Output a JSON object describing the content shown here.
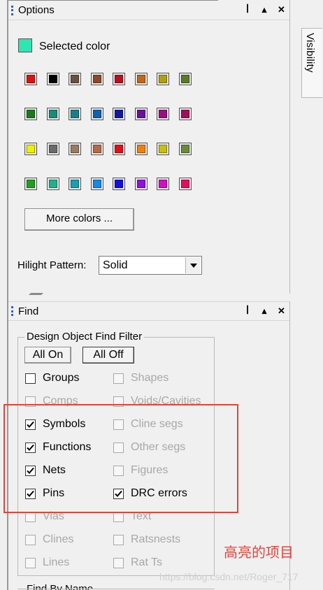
{
  "options_panel": {
    "title": "Options",
    "pin_icon": "pin-icon",
    "menu_icon": "triangle-up-icon",
    "close_icon": "close-icon",
    "selected_color": {
      "label": "Selected color",
      "color": "#2ee6b2"
    },
    "palette": [
      [
        "#e01010",
        "#000000",
        "#6b5040",
        "#8a4a2a",
        "#b81020",
        "#c06818",
        "#b0a010",
        "#5a7a2a"
      ],
      [
        "#1a7a1a",
        "#1a8a7a",
        "#18808a",
        "#1060b0",
        "#101a9a",
        "#6a109a",
        "#9a1080",
        "#a0105a"
      ],
      [
        "#f0f000",
        "#6a6a6a",
        "#9a7a60",
        "#b86848",
        "#e0101a",
        "#f08010",
        "#c8c010",
        "#6a8a3a"
      ],
      [
        "#20a020",
        "#20b090",
        "#18a0b0",
        "#1888e0",
        "#1010e0",
        "#9010e0",
        "#d010c0",
        "#e01060"
      ]
    ],
    "more_colors_label": "More colors ...",
    "hilight_pattern": {
      "label": "Hilight Pattern:",
      "value": "Solid"
    }
  },
  "visibility_tab": {
    "label": "Visibility"
  },
  "find_panel": {
    "title": "Find",
    "filter_group_label": "Design Object Find Filter",
    "all_on_label": "All On",
    "all_off_label": "All Off",
    "left_column": [
      {
        "label": "Groups",
        "checked": false,
        "enabled": true
      },
      {
        "label": "Comps",
        "checked": false,
        "enabled": false
      },
      {
        "label": "Symbols",
        "checked": true,
        "enabled": true
      },
      {
        "label": "Functions",
        "checked": true,
        "enabled": true
      },
      {
        "label": "Nets",
        "checked": true,
        "enabled": true
      },
      {
        "label": "Pins",
        "checked": true,
        "enabled": true
      },
      {
        "label": "Vias",
        "checked": false,
        "enabled": false
      },
      {
        "label": "Clines",
        "checked": false,
        "enabled": false
      },
      {
        "label": "Lines",
        "checked": false,
        "enabled": false
      }
    ],
    "right_column": [
      {
        "label": "Shapes",
        "checked": false,
        "enabled": false
      },
      {
        "label": "Voids/Cavities",
        "checked": false,
        "enabled": false
      },
      {
        "label": "Cline segs",
        "checked": false,
        "enabled": false
      },
      {
        "label": "Other segs",
        "checked": false,
        "enabled": false
      },
      {
        "label": "Figures",
        "checked": false,
        "enabled": false
      },
      {
        "label": "DRC errors",
        "checked": true,
        "enabled": true
      },
      {
        "label": "Text",
        "checked": false,
        "enabled": false
      },
      {
        "label": "Ratsnests",
        "checked": false,
        "enabled": false
      },
      {
        "label": "Rat Ts",
        "checked": false,
        "enabled": false
      }
    ],
    "find_by_name_label": "Find By Name"
  },
  "annotation": {
    "note": "高亮的项目",
    "color": "#e4433a"
  },
  "watermark": "https://blog.csdn.net/Roger_717"
}
